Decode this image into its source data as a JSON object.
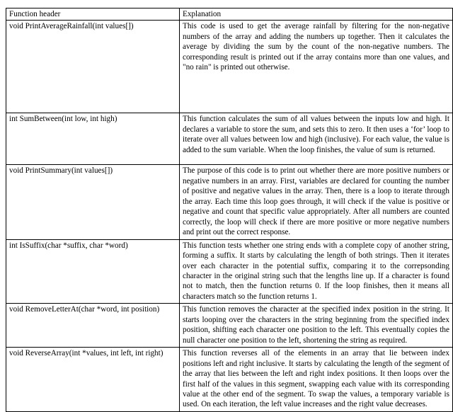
{
  "table": {
    "columns": [
      {
        "key": "function_header",
        "label": "Function header"
      },
      {
        "key": "explanation",
        "label": "Explanation"
      }
    ],
    "rows": [
      {
        "function_header": "void PrintAverageRainfall(int values[])",
        "explanation": "This code is used to get the average rainfall by filtering for the non-negative numbers of the array and adding the numbers up together. Then it calculates the average by dividing the sum by the count of the non-negative numbers. The corresponding result is printed out if the array contains more than one values, and \"no rain\" is printed out otherwise."
      },
      {
        "function_header": "int SumBetween(int low, int high)",
        "explanation": "This function calculates the sum of all values between the inputs low and high. It declares a variable to store the sum, and sets this to zero. It then uses a ‘for’ loop to iterate over all values between low and high (inclusive). For each value, the value is added to the sum variable. When the loop finishes, the value of sum is returned."
      },
      {
        "function_header": "void PrintSummary(int values[])",
        "explanation": "The purpose of this code is to print out whether there are more positive numbers or negative numbers in an array. First, variables are declared for counting the number of positive and negative values in the array. Then, there is a loop to iterate through the array. Each time this loop goes through, it will check if the value is positive or negative and count that specific value appropriately. After all numbers are counted correctly, the loop will check if there are more positive or more negative numbers and print out the correct response."
      },
      {
        "function_header": "int IsSuffix(char *suffix, char *word)",
        "explanation": "This function tests whether one string ends with a complete copy of another string, forming a suffix. It starts by calculating the length of both strings. Then it iterates over each character in the potential suffix, comparing it to the correpsonding character in the original string such that the lengths line up. If a character is found not to match, then the function returns 0. If the loop finishes, then it means all characters match so the function returns 1."
      },
      {
        "function_header": "void RemoveLetterAt(char *word, int position)",
        "explanation": "This function removes the character at the specified index position in the string. It starts looping over the characters in the string beginning from the specified index position, shifting each character one position to the left. This eventually copies the null character one position to the left, shortening the string as required."
      },
      {
        "function_header": "void ReverseArray(int *values, int left, int right)",
        "explanation": "This function reverses all of the elements in an array that lie between index positions left and right inclusive. It starts by calculating the length of the segment of the array that lies between the left and right index positions. It then loops over the first half of the values in this segment, swapping each value with its corresponding value at the other end of the segment. To swap the values, a temporary variable is used. On each iteration, the left value increases and the right value decreases."
      }
    ]
  }
}
